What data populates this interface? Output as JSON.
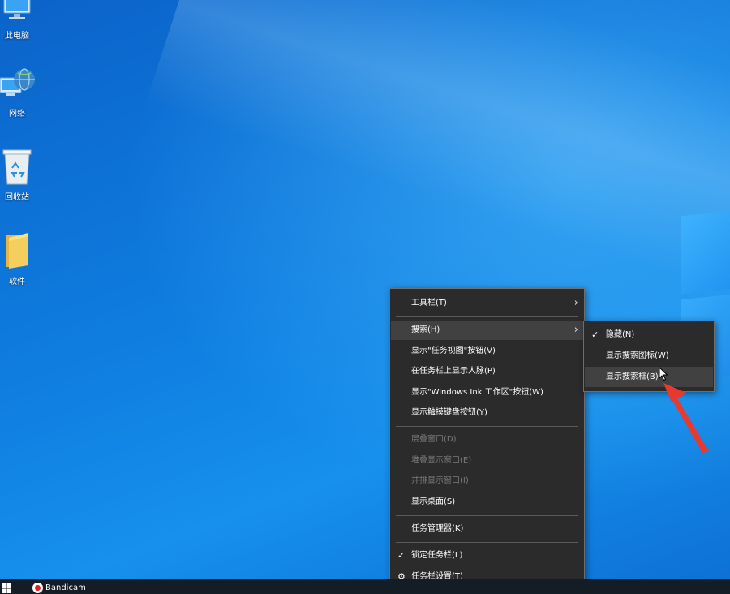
{
  "desktop": {
    "icons": [
      {
        "label": "此电脑",
        "icon": "this-pc-icon"
      },
      {
        "label": "网络",
        "icon": "network-icon"
      },
      {
        "label": "回收站",
        "icon": "recycle-bin-icon"
      },
      {
        "label": "软件",
        "icon": "folder-icon"
      }
    ]
  },
  "context_menu": {
    "items": {
      "toolbars": "工具栏(T)",
      "search": "搜索(H)",
      "task_view": "显示\"任务视图\"按钮(V)",
      "people": "在任务栏上显示人脉(P)",
      "windows_ink": "显示\"Windows Ink 工作区\"按钮(W)",
      "touch_keyboard": "显示触摸键盘按钮(Y)",
      "cascade": "层叠窗口(D)",
      "stacked": "堆叠显示窗口(E)",
      "side_by_side": "并排显示窗口(I)",
      "show_desktop": "显示桌面(S)",
      "task_manager": "任务管理器(K)",
      "lock_taskbar": "锁定任务栏(L)",
      "taskbar_settings": "任务栏设置(T)"
    }
  },
  "search_submenu": {
    "hidden": "隐藏(N)",
    "show_icon": "显示搜索图标(W)",
    "show_box": "显示搜索框(B)"
  },
  "glyphs": {
    "arrow": "›",
    "check": "✓",
    "gear": "⚙"
  },
  "taskbar": {
    "app": "Bandicam"
  },
  "colors": {
    "menu_bg": "#2b2b2b",
    "menu_highlight": "#414141",
    "annotation_arrow": "#e8392f"
  }
}
